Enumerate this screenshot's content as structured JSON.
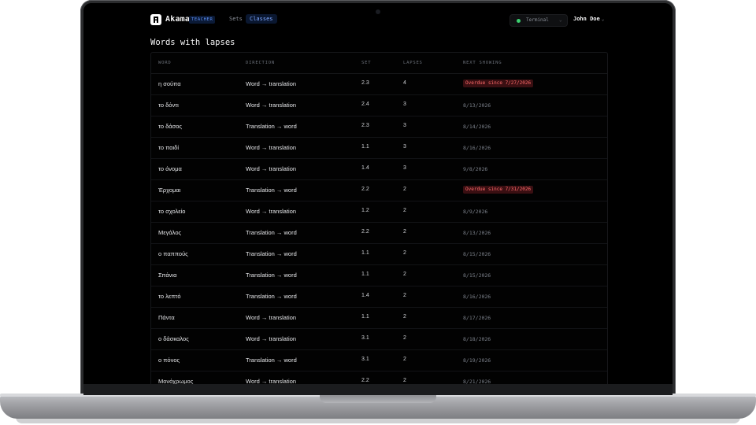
{
  "app": {
    "brand": "Akama",
    "role_badge": "TEACHER",
    "nav": {
      "sets": "Sets",
      "classes": "Classes"
    },
    "terminal": {
      "label": "Terminal",
      "caret": "⌄"
    },
    "user": {
      "name": "John Doe",
      "caret": "⌄"
    }
  },
  "page": {
    "title": "Words with lapses"
  },
  "table": {
    "headers": [
      "WORD",
      "DIRECTION",
      "SET",
      "LAPSES",
      "NEXT SHOWING"
    ],
    "rows": [
      {
        "word": "η σούπα",
        "direction": "Word → translation",
        "set": "2.3",
        "lapses": "4",
        "next": "Overdue since 7/27/2026",
        "overdue": true
      },
      {
        "word": "το δόντι",
        "direction": "Word → translation",
        "set": "2.4",
        "lapses": "3",
        "next": "8/13/2026",
        "overdue": false
      },
      {
        "word": "το δάσος",
        "direction": "Translation → word",
        "set": "2.3",
        "lapses": "3",
        "next": "8/14/2026",
        "overdue": false
      },
      {
        "word": "το παιδί",
        "direction": "Word → translation",
        "set": "1.1",
        "lapses": "3",
        "next": "8/16/2026",
        "overdue": false
      },
      {
        "word": "το όνομα",
        "direction": "Word → translation",
        "set": "1.4",
        "lapses": "3",
        "next": "9/8/2026",
        "overdue": false
      },
      {
        "word": "Έρχομαι",
        "direction": "Translation → word",
        "set": "2.2",
        "lapses": "2",
        "next": "Overdue since 7/31/2026",
        "overdue": true
      },
      {
        "word": "το σχολείο",
        "direction": "Word → translation",
        "set": "1.2",
        "lapses": "2",
        "next": "8/9/2026",
        "overdue": false
      },
      {
        "word": "Μεγάλος",
        "direction": "Translation → word",
        "set": "2.2",
        "lapses": "2",
        "next": "8/13/2026",
        "overdue": false
      },
      {
        "word": "ο παππούς",
        "direction": "Translation → word",
        "set": "1.1",
        "lapses": "2",
        "next": "8/15/2026",
        "overdue": false
      },
      {
        "word": "Σπάνια",
        "direction": "Translation → word",
        "set": "1.1",
        "lapses": "2",
        "next": "8/15/2026",
        "overdue": false
      },
      {
        "word": "το λεπτό",
        "direction": "Translation → word",
        "set": "1.4",
        "lapses": "2",
        "next": "8/16/2026",
        "overdue": false
      },
      {
        "word": "Πάντα",
        "direction": "Word → translation",
        "set": "1.1",
        "lapses": "2",
        "next": "8/17/2026",
        "overdue": false
      },
      {
        "word": "ο δάσκαλος",
        "direction": "Word → translation",
        "set": "3.1",
        "lapses": "2",
        "next": "8/18/2026",
        "overdue": false
      },
      {
        "word": "ο πόνος",
        "direction": "Translation → word",
        "set": "3.1",
        "lapses": "2",
        "next": "8/19/2026",
        "overdue": false
      },
      {
        "word": "Μονόχρωμος",
        "direction": "Word → translation",
        "set": "2.2",
        "lapses": "2",
        "next": "8/21/2026",
        "overdue": false
      }
    ]
  }
}
